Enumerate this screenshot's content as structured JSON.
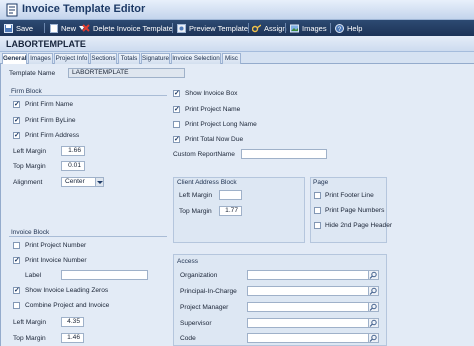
{
  "window": {
    "title": "Invoice Template Editor"
  },
  "toolbar": {
    "save": "Save",
    "new": "New",
    "delete": "Delete Invoice Template",
    "preview": "Preview Template",
    "assign": "Assign",
    "images": "Images",
    "help": "Help"
  },
  "header": {
    "title": "LABORTEMPLATE"
  },
  "tabs": [
    "General",
    "Images",
    "Project Info",
    "Sections",
    "Totals",
    "Signature",
    "Invoice Selection",
    "Misc"
  ],
  "general": {
    "template_name_label": "Template Name",
    "template_name_value": "LABORTEMPLATE",
    "firm_block": {
      "title": "Firm Block",
      "print_firm_name": "Print Firm Name",
      "print_firm_byline": "Print Firm ByLine",
      "print_firm_address": "Print Firm Address",
      "left_margin_label": "Left Margin",
      "left_margin_value": "1.66",
      "top_margin_label": "Top Margin",
      "top_margin_value": "0.01",
      "alignment_label": "Alignment",
      "alignment_value": "Center"
    },
    "invoice_options": {
      "show_invoice_box": "Show Invoice Box",
      "print_project_name": "Print Project Name",
      "print_project_long_name": "Print Project Long Name",
      "print_total_now_due": "Print Total Now Due",
      "custom_report_name_label": "Custom ReportName",
      "custom_report_name_value": ""
    },
    "client_address_block": {
      "title": "Client Address Block",
      "left_margin_label": "Left Margin",
      "left_margin_value": "",
      "top_margin_label": "Top Margin",
      "top_margin_value": "1.77"
    },
    "page": {
      "title": "Page",
      "print_footer_line": "Print Footer Line",
      "print_page_numbers": "Print Page Numbers",
      "hide_2nd_page_header": "Hide 2nd Page Header"
    },
    "invoice_block": {
      "title": "Invoice Block",
      "print_project_number": "Print Project Number",
      "print_invoice_number": "Print Invoice Number",
      "label_label": "Label",
      "label_value": "",
      "show_invoice_leading_zeros": "Show Invoice Leading Zeros",
      "combine_project_and_invoice": "Combine Project and Invoice",
      "left_margin_label": "Left Margin",
      "left_margin_value": "4.35",
      "top_margin_label": "Top Margin",
      "top_margin_value": "1.46"
    },
    "access": {
      "title": "Access",
      "organization": "Organization",
      "principal_in_charge": "Principal-In-Charge",
      "project_manager": "Project Manager",
      "supervisor": "Supervisor",
      "code": "Code"
    }
  },
  "colors": {
    "toolbar_bg": "#1c3357",
    "accent": "#1d3a66",
    "panel_bg": "#e3ebf6"
  }
}
